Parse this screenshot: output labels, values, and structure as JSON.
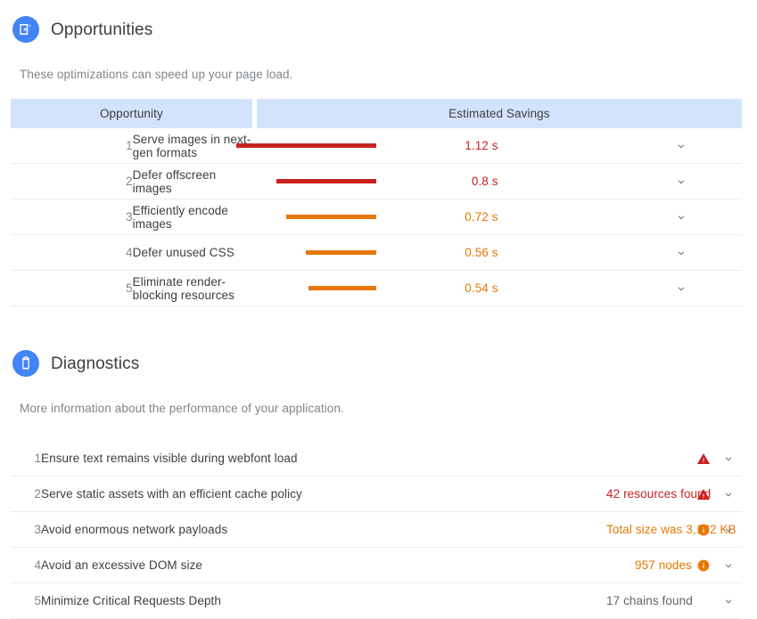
{
  "opportunities": {
    "icon": "image-plus-icon",
    "title": "Opportunities",
    "description": "These optimizations can speed up your page load.",
    "columns": {
      "name": "Opportunity",
      "savings": "Estimated Savings"
    },
    "rows": [
      {
        "index": "1",
        "title": "Serve images in next-gen formats",
        "value": "1.12 s",
        "seconds": 1.12,
        "severity": "red",
        "chevron": "chevron-down-icon"
      },
      {
        "index": "2",
        "title": "Defer offscreen images",
        "value": "0.8 s",
        "seconds": 0.8,
        "severity": "red",
        "chevron": "chevron-down-icon"
      },
      {
        "index": "3",
        "title": "Efficiently encode images",
        "value": "0.72 s",
        "seconds": 0.72,
        "severity": "orange",
        "chevron": "chevron-down-icon"
      },
      {
        "index": "4",
        "title": "Defer unused CSS",
        "value": "0.56 s",
        "seconds": 0.56,
        "severity": "orange",
        "chevron": "chevron-down-icon"
      },
      {
        "index": "5",
        "title": "Eliminate render-blocking resources",
        "value": "0.54 s",
        "seconds": 0.54,
        "severity": "orange",
        "chevron": "chevron-down-icon"
      }
    ]
  },
  "diagnostics": {
    "icon": "clipboard-icon",
    "title": "Diagnostics",
    "description": "More information about the performance of your application.",
    "rows": [
      {
        "index": "1",
        "title": "Ensure text remains visible during webfont load",
        "value": "",
        "badge": "warning-triangle-icon",
        "severity": "red",
        "chevron": "chevron-down-icon"
      },
      {
        "index": "2",
        "title": "Serve static assets with an efficient cache policy",
        "value": "42 resources found",
        "badge": "warning-triangle-icon",
        "severity": "red",
        "chevron": "chevron-down-icon"
      },
      {
        "index": "3",
        "title": "Avoid enormous network payloads",
        "value": "Total size was 3,172 KB",
        "badge": "info-circle-icon",
        "severity": "orange",
        "chevron": "chevron-down-icon"
      },
      {
        "index": "4",
        "title": "Avoid an excessive DOM size",
        "value": "957 nodes",
        "badge": "info-circle-icon",
        "severity": "orange",
        "chevron": "chevron-down-icon"
      },
      {
        "index": "5",
        "title": "Minimize Critical Requests Depth",
        "value": "17 chains found",
        "badge": "",
        "severity": "grey",
        "chevron": "chevron-down-icon"
      }
    ]
  },
  "colors": {
    "accent_blue": "#4285f4",
    "header_bg": "#d3e3fd",
    "severity_red": "#c7221f",
    "severity_orange": "#e67700",
    "text_primary": "#3c4043",
    "text_secondary": "#80868b"
  }
}
